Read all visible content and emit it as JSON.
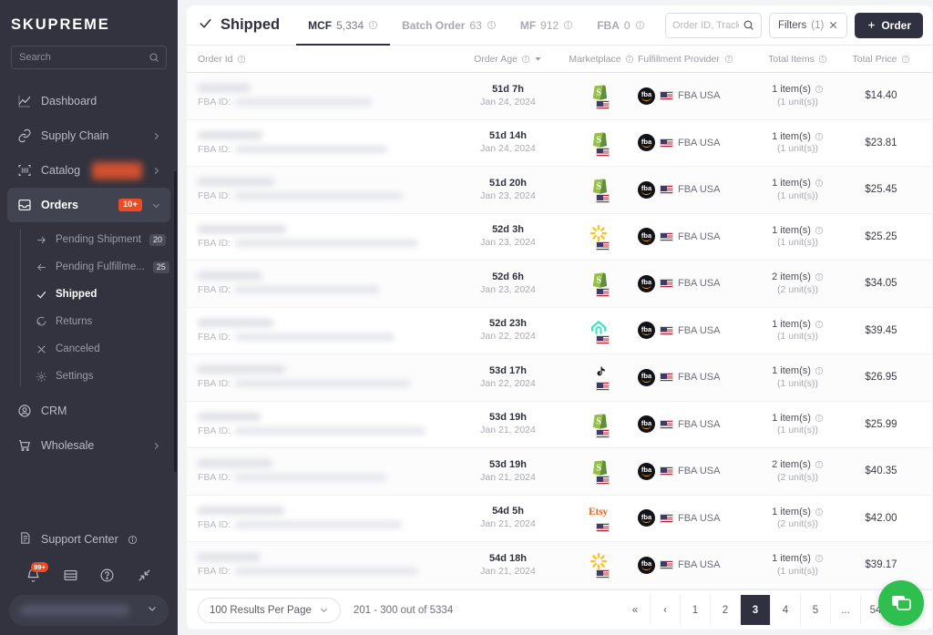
{
  "brand": {
    "name": "SKUPREME"
  },
  "sidebar": {
    "search_placeholder": "Search",
    "items": [
      {
        "label": "Dashboard",
        "icon": "chart-line-icon",
        "chevron": false,
        "badge": null
      },
      {
        "label": "Supply Chain",
        "icon": "link-icon",
        "chevron": true,
        "badge": null
      },
      {
        "label": "Catalog",
        "icon": "barcode-icon",
        "chevron": true,
        "badge": "redacted"
      },
      {
        "label": "Orders",
        "icon": "inbox-icon",
        "chevron": true,
        "badge": "10+"
      }
    ],
    "orders_sub": [
      {
        "label": "Pending Shipment",
        "icon": "arrow-right-icon",
        "count": "20",
        "active": false
      },
      {
        "label": "Pending Fulfillme...",
        "icon": "arrow-left-icon",
        "count": "25",
        "active": false
      },
      {
        "label": "Shipped",
        "icon": "check-icon",
        "count": null,
        "active": true
      },
      {
        "label": "Returns",
        "icon": "undo-icon",
        "count": null,
        "active": false
      },
      {
        "label": "Canceled",
        "icon": "close-icon",
        "count": null,
        "active": false
      },
      {
        "label": "Settings",
        "icon": "gear-icon",
        "count": null,
        "active": false
      }
    ],
    "items_after": [
      {
        "label": "CRM",
        "icon": "user-circle-icon",
        "chevron": false
      },
      {
        "label": "Wholesale",
        "icon": "cart-icon",
        "chevron": true
      }
    ],
    "support": {
      "label": "Support Center",
      "icon": "document-icon"
    },
    "footer_icons": [
      {
        "name": "bell-icon",
        "badge": "99+"
      },
      {
        "name": "table-icon",
        "badge": null
      },
      {
        "name": "help-circle-icon",
        "badge": null
      },
      {
        "name": "collapse-icon",
        "badge": null
      }
    ]
  },
  "header": {
    "title": "Shipped",
    "title_icon": "check-icon",
    "tabs": [
      {
        "label": "MCF",
        "count": "5,334",
        "active": true
      },
      {
        "label": "Batch Order",
        "count": "63",
        "active": false
      },
      {
        "label": "MF",
        "count": "912",
        "active": false
      },
      {
        "label": "FBA",
        "count": "0",
        "active": false
      }
    ],
    "search_placeholder": "Order ID, Tracking #",
    "filters_label": "Filters",
    "filters_count": "(1)",
    "order_button": "Order"
  },
  "table": {
    "columns": [
      {
        "label": "Order Id",
        "info": true,
        "sort": false
      },
      {
        "label": "Order Age",
        "info": true,
        "sort": true
      },
      {
        "label": "Marketplace",
        "info": true,
        "sort": false
      },
      {
        "label": "Fulfillment Provider",
        "info": true,
        "sort": false
      },
      {
        "label": "Total Items",
        "info": true,
        "sort": false
      },
      {
        "label": "Total Price",
        "info": true,
        "sort": false
      }
    ],
    "fba_id_label": "FBA ID:",
    "rows": [
      {
        "age": "51d 7h",
        "date": "Jan 24, 2024",
        "marketplace": "shopify-icon",
        "provider": "FBA USA",
        "items": "1 item(s)",
        "units": "(1 unit(s))",
        "price": "$14.40"
      },
      {
        "age": "51d 14h",
        "date": "Jan 24, 2024",
        "marketplace": "shopify-icon",
        "provider": "FBA USA",
        "items": "1 item(s)",
        "units": "(1 unit(s))",
        "price": "$23.81"
      },
      {
        "age": "51d 20h",
        "date": "Jan 23, 2024",
        "marketplace": "shopify-icon",
        "provider": "FBA USA",
        "items": "1 item(s)",
        "units": "(1 unit(s))",
        "price": "$25.45"
      },
      {
        "age": "52d 3h",
        "date": "Jan 23, 2024",
        "marketplace": "walmart-icon",
        "provider": "FBA USA",
        "items": "1 item(s)",
        "units": "(1 unit(s))",
        "price": "$25.25"
      },
      {
        "age": "52d 6h",
        "date": "Jan 23, 2024",
        "marketplace": "shopify-icon",
        "provider": "FBA USA",
        "items": "2 item(s)",
        "units": "(2 unit(s))",
        "price": "$34.05"
      },
      {
        "age": "52d 23h",
        "date": "Jan 22, 2024",
        "marketplace": "homedepot-icon",
        "provider": "FBA USA",
        "items": "1 item(s)",
        "units": "(1 unit(s))",
        "price": "$39.45"
      },
      {
        "age": "53d 17h",
        "date": "Jan 22, 2024",
        "marketplace": "tiktok-icon",
        "provider": "FBA USA",
        "items": "1 item(s)",
        "units": "(1 unit(s))",
        "price": "$26.95"
      },
      {
        "age": "53d 19h",
        "date": "Jan 21, 2024",
        "marketplace": "shopify-icon",
        "provider": "FBA USA",
        "items": "1 item(s)",
        "units": "(1 unit(s))",
        "price": "$25.99"
      },
      {
        "age": "53d 19h",
        "date": "Jan 21, 2024",
        "marketplace": "shopify-icon",
        "provider": "FBA USA",
        "items": "2 item(s)",
        "units": "(2 unit(s))",
        "price": "$40.35"
      },
      {
        "age": "54d 5h",
        "date": "Jan 21, 2024",
        "marketplace": "etsy-icon",
        "provider": "FBA USA",
        "items": "1 item(s)",
        "units": "(2 unit(s))",
        "price": "$42.00"
      },
      {
        "age": "54d 18h",
        "date": "Jan 21, 2024",
        "marketplace": "walmart-icon",
        "provider": "FBA USA",
        "items": "1 item(s)",
        "units": "(1 unit(s))",
        "price": "$39.17"
      }
    ]
  },
  "footer": {
    "results_per_page": "100 Results Per Page",
    "range": "201 - 300 out of 5334",
    "pages": [
      {
        "label": "«",
        "name": "first",
        "current": false
      },
      {
        "label": "‹",
        "name": "prev",
        "current": false
      },
      {
        "label": "1",
        "name": "page-1",
        "current": false
      },
      {
        "label": "2",
        "name": "page-2",
        "current": false
      },
      {
        "label": "3",
        "name": "page-3",
        "current": true
      },
      {
        "label": "4",
        "name": "page-4",
        "current": false
      },
      {
        "label": "5",
        "name": "page-5",
        "current": false
      },
      {
        "label": "...",
        "name": "ellipsis",
        "current": false
      },
      {
        "label": "54",
        "name": "page-54",
        "current": false
      },
      {
        "label": "›",
        "name": "next",
        "current": false
      }
    ]
  },
  "colors": {
    "accent": "#f04a23",
    "dark": "#2f3040",
    "sidebar": "#32333f",
    "chat": "#2fbf4f"
  }
}
